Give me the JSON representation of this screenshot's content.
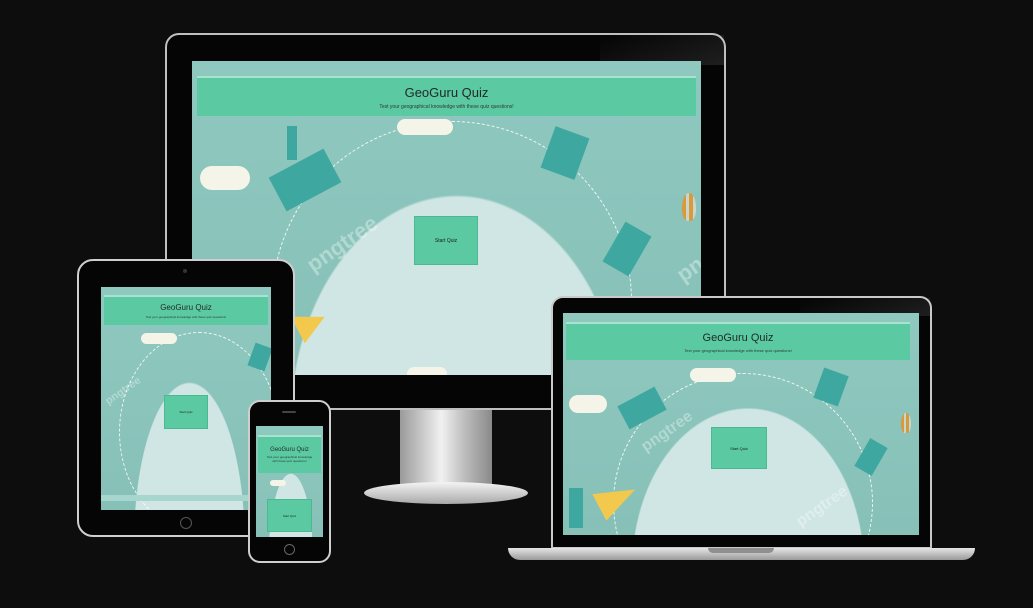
{
  "site": {
    "title": "GeoGuru Quiz",
    "subtitle": "Test your geographical knowledge with these quiz questions!",
    "subtitle_phone": "Test your geographical knowledge with these quiz questions!",
    "start_label": "Start Quiz"
  },
  "colors": {
    "background": "#0d0d0d",
    "header_green": "#5bc9a2",
    "sky_teal": "#8cc5bd",
    "globe": "#cfe6e5"
  },
  "watermark": "pngtree",
  "devices": [
    "desktop-monitor",
    "tablet",
    "smartphone",
    "laptop"
  ]
}
